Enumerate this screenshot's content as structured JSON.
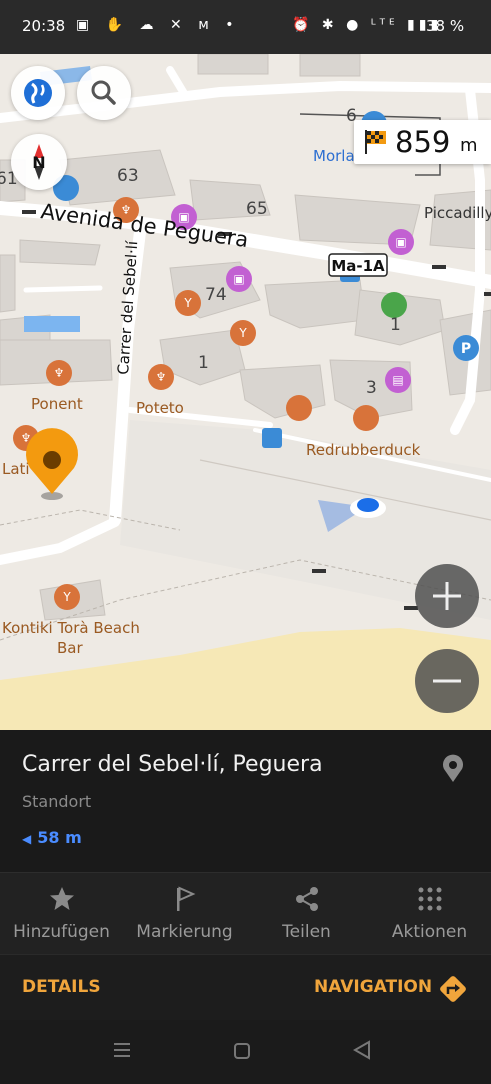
{
  "status_bar": {
    "time": "20:38",
    "left_icons": "▣ ✋ ☁ ✕ ᴍ •",
    "right_icons": "⏰ ✱ ● ᴸᵀᴱ ▮▮▮",
    "battery": "38 %"
  },
  "map": {
    "distance_value": "859",
    "distance_unit": "m",
    "labels": {
      "street_main": "Avenida de Peguera",
      "street_side": "Carrer del Sebel·lí",
      "road_ref": "Ma-1A",
      "garden": "Morlans Garden",
      "piccadilly": "Piccadilly",
      "ponent": "Ponent",
      "poteto": "Poteto",
      "redrubberduck": "Redrubberduck",
      "lati": "Lati",
      "kontiki_1": "Kontiki Torà Beach",
      "kontiki_2": "Bar",
      "n6": "6",
      "n63": "63",
      "n65": "65",
      "n74": "74",
      "n1a": "1",
      "n1b": "1",
      "n3": "3",
      "n61": "61"
    }
  },
  "info_panel": {
    "title": "Carrer del Sebel·lí, Peguera",
    "subtitle": "Standort",
    "distance": "58 m"
  },
  "actions": {
    "add": "Hinzufügen",
    "marker": "Markierung",
    "share": "Teilen",
    "actions": "Aktionen"
  },
  "buttons": {
    "details": "DETAILS",
    "navigation": "NAVIGATION"
  },
  "colors": {
    "accent": "#f0a53c",
    "distance_blue": "#4a8cff",
    "poi_orange": "#d8733a",
    "poi_purple": "#c260d2",
    "poi_blue": "#3b8bd6",
    "sand": "#f6e8b6"
  }
}
